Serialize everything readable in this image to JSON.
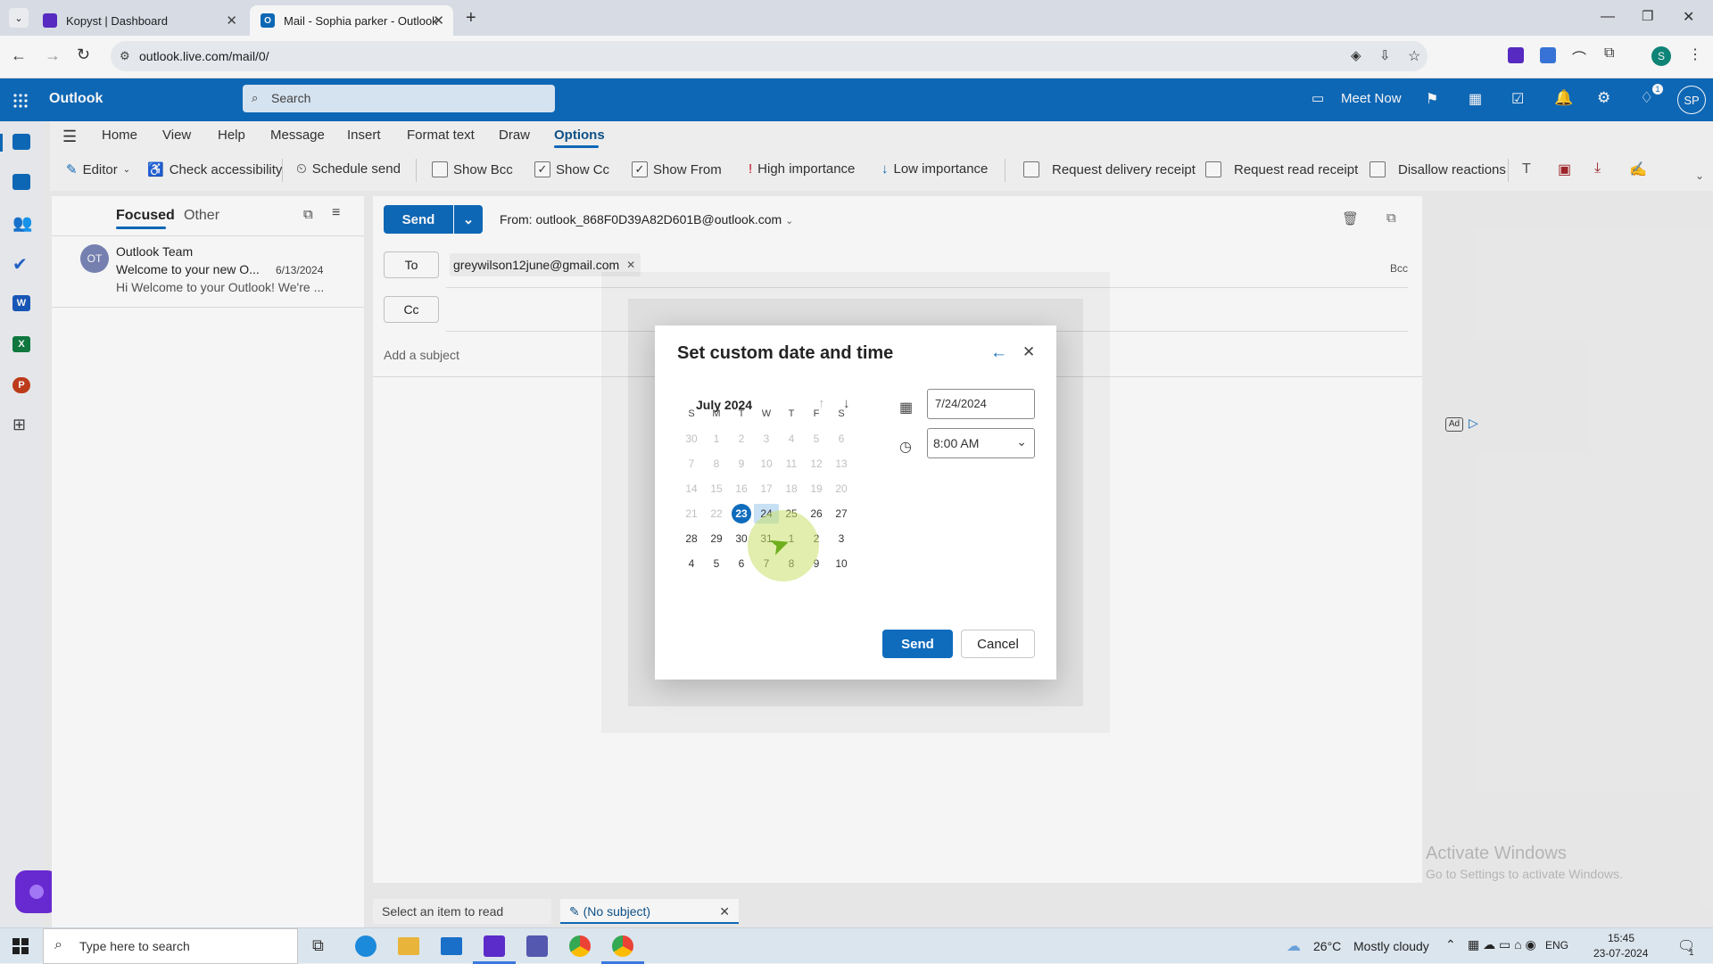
{
  "browser": {
    "tabs": [
      {
        "title": "Kopyst | Dashboard",
        "active": false
      },
      {
        "title": "Mail - Sophia parker - Outlook",
        "active": true
      }
    ],
    "url": "outlook.live.com/mail/0/"
  },
  "header": {
    "app_name": "Outlook",
    "search_placeholder": "Search",
    "meet_now": "Meet Now",
    "notification_badge": "1",
    "avatar_initials": "SP"
  },
  "ribbon": {
    "tabs": [
      "Home",
      "View",
      "Help",
      "Message",
      "Insert",
      "Format text",
      "Draw",
      "Options"
    ],
    "active_tab": "Options",
    "commands": {
      "editor": "Editor",
      "check_accessibility": "Check accessibility",
      "schedule_send": "Schedule send",
      "show_bcc": "Show Bcc",
      "show_cc": "Show Cc",
      "show_from": "Show From",
      "high_importance": "High importance",
      "low_importance": "Low importance",
      "request_delivery_receipt": "Request delivery receipt",
      "request_read_receipt": "Request read receipt",
      "disallow_reactions": "Disallow reactions"
    },
    "checkbox_states": {
      "show_bcc": false,
      "show_cc": true,
      "show_from": true,
      "request_delivery_receipt": false,
      "request_read_receipt": false,
      "disallow_reactions": false
    }
  },
  "maillist": {
    "tabs": {
      "focused": "Focused",
      "other": "Other"
    },
    "items": [
      {
        "initials": "OT",
        "sender": "Outlook Team",
        "subject": "Welcome to your new O...",
        "date": "6/13/2024",
        "preview": "Hi Welcome to your Outlook! We're ..."
      }
    ]
  },
  "compose": {
    "send_label": "Send",
    "from_label": "From: ",
    "from_address": "outlook_868F0D39A82D601B@outlook.com",
    "to_label": "To",
    "to_recipient": "greywilson12june@gmail.com",
    "cc_label": "Cc",
    "bcc_label": "Bcc",
    "subject_placeholder": "Add a subject",
    "ad_label": "Ad"
  },
  "dialog": {
    "title": "Set custom date and time",
    "month_label": "July 2024",
    "weekdays": [
      "S",
      "M",
      "T",
      "W",
      "T",
      "F",
      "S"
    ],
    "weeks": [
      [
        "30",
        "1",
        "2",
        "3",
        "4",
        "5",
        "6"
      ],
      [
        "7",
        "8",
        "9",
        "10",
        "11",
        "12",
        "13"
      ],
      [
        "14",
        "15",
        "16",
        "17",
        "18",
        "19",
        "20"
      ],
      [
        "21",
        "22",
        "23",
        "24",
        "25",
        "26",
        "27"
      ],
      [
        "28",
        "29",
        "30",
        "31",
        "1",
        "2",
        "3"
      ],
      [
        "4",
        "5",
        "6",
        "7",
        "8",
        "9",
        "10"
      ]
    ],
    "today": "23",
    "selected": "24",
    "date_value": "7/24/2024",
    "time_value": "8:00 AM",
    "send_label": "Send",
    "cancel_label": "Cancel"
  },
  "bottom_tabs": {
    "select_item": "Select an item to read",
    "draft": "(No subject)"
  },
  "watermark": {
    "line1": "Activate Windows",
    "line2": "Go to Settings to activate Windows."
  },
  "taskbar": {
    "search_placeholder": "Type here to search",
    "weather_temp": "26°C",
    "weather_desc": "Mostly cloudy",
    "language": "ENG",
    "time": "15:45",
    "date": "23-07-2024",
    "notification_count": "1"
  },
  "colors": {
    "brand_blue": "#0f6cbd",
    "today_circle": "#0f6cbd",
    "selected_day": "#c7e0f4",
    "click_indicator": "#c8e06c"
  }
}
